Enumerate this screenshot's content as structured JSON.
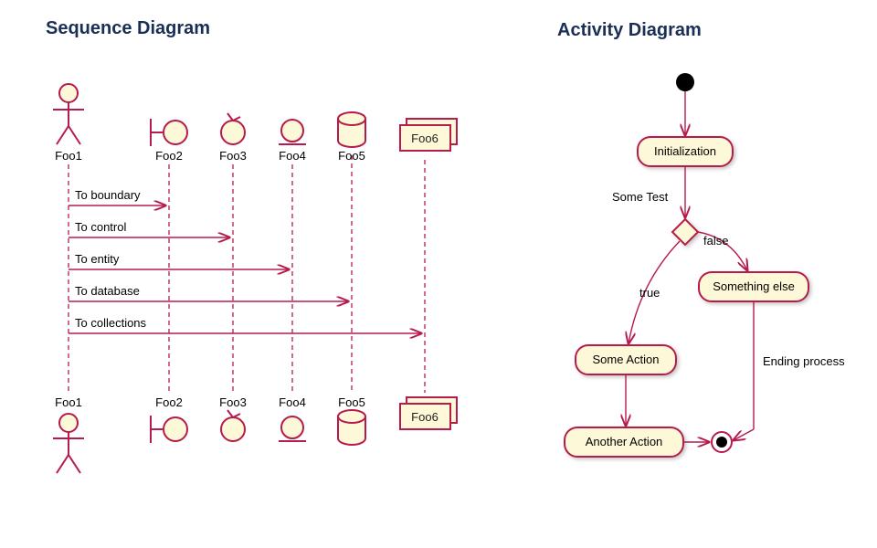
{
  "titles": {
    "left": "Sequence Diagram",
    "right": "Activity Diagram"
  },
  "sequence": {
    "participants": [
      {
        "name": "Foo1",
        "type": "actor"
      },
      {
        "name": "Foo2",
        "type": "boundary"
      },
      {
        "name": "Foo3",
        "type": "control"
      },
      {
        "name": "Foo4",
        "type": "entity"
      },
      {
        "name": "Foo5",
        "type": "database"
      },
      {
        "name": "Foo6",
        "type": "collections"
      }
    ],
    "messages": [
      {
        "from": "Foo1",
        "to": "Foo2",
        "label": "To boundary"
      },
      {
        "from": "Foo1",
        "to": "Foo3",
        "label": "To control"
      },
      {
        "from": "Foo1",
        "to": "Foo4",
        "label": "To entity"
      },
      {
        "from": "Foo1",
        "to": "Foo5",
        "label": "To database"
      },
      {
        "from": "Foo1",
        "to": "Foo6",
        "label": "To collections"
      }
    ]
  },
  "activity": {
    "nodes": [
      {
        "id": "start",
        "type": "start"
      },
      {
        "id": "init",
        "type": "action",
        "label": "Initialization"
      },
      {
        "id": "decision",
        "type": "decision",
        "testLabel": "Some Test"
      },
      {
        "id": "someAction",
        "type": "action",
        "label": "Some Action"
      },
      {
        "id": "somethingElse",
        "type": "action",
        "label": "Something else"
      },
      {
        "id": "anotherAction",
        "type": "action",
        "label": "Another Action"
      },
      {
        "id": "end",
        "type": "end"
      }
    ],
    "edges": [
      {
        "from": "start",
        "to": "init"
      },
      {
        "from": "init",
        "to": "decision",
        "label": "Some Test"
      },
      {
        "from": "decision",
        "to": "someAction",
        "label": "true"
      },
      {
        "from": "decision",
        "to": "somethingElse",
        "label": "false"
      },
      {
        "from": "someAction",
        "to": "anotherAction"
      },
      {
        "from": "somethingElse",
        "to": "end",
        "label": "Ending process"
      },
      {
        "from": "anotherAction",
        "to": "end"
      }
    ]
  },
  "colors": {
    "outline": "#b61b4b",
    "fill": "#fdf8d7",
    "titleColor": "#1a2f55"
  }
}
